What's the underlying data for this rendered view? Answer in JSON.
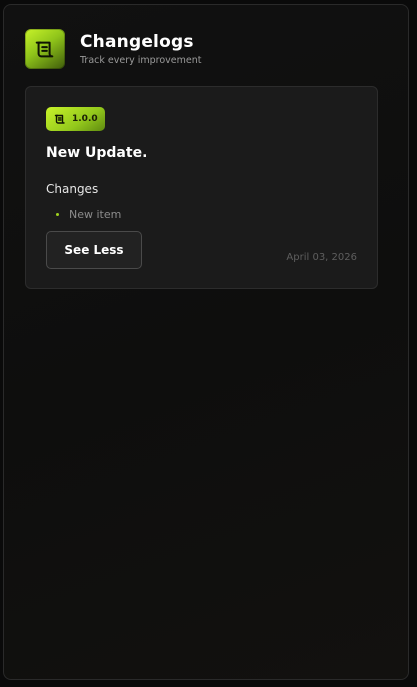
{
  "header": {
    "title": "Changelogs",
    "subtitle": "Track every improvement"
  },
  "entry": {
    "version": "1.0.0",
    "title": "New Update.",
    "changes_label": "Changes",
    "changes": [
      "New item"
    ],
    "toggle_label": "See Less",
    "date": "April 03, 2026"
  },
  "colors": {
    "accent": "#b5e625",
    "background": "#0a0a0a",
    "card": "#1b1b1b"
  },
  "icons": {
    "logo": "scroll-icon",
    "badge": "scroll-icon",
    "bullet": "bullet-dot-icon"
  }
}
